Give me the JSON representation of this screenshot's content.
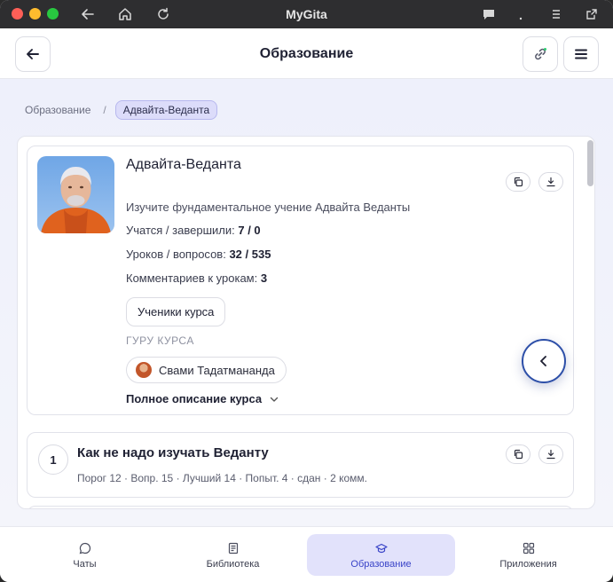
{
  "window": {
    "title": "MyGita"
  },
  "header": {
    "title": "Образование"
  },
  "breadcrumb": {
    "root": "Образование",
    "separator": "/",
    "current": "Адвайта-Веданта"
  },
  "course": {
    "title": "Адвайта-Веданта",
    "description": "Изучите фундаментальное учение Адвайта Веданты",
    "learning_label": "Учатся / завершили:",
    "learning_value": "7 / 0",
    "lessons_label": "Уроков / вопросов:",
    "lessons_value": "32 / 535",
    "comments_label": "Комментариев к урокам:",
    "comments_value": "3",
    "students_button": "Ученики курса",
    "guru_label": "ГУРУ КУРСА",
    "guru_name": "Свами Тадатмананда",
    "full_description": "Полное описание курса"
  },
  "lessons": [
    {
      "number": "1",
      "title": "Как не надо изучать Веданту",
      "meta": "Порог 12 · Вопр. 15 · Лучший 14 · Попыт. 4 · сдан · 2 комм."
    }
  ],
  "bottom_nav": [
    {
      "label": "Чаты",
      "icon": "chat-icon",
      "active": false
    },
    {
      "label": "Библиотека",
      "icon": "book-icon",
      "active": false
    },
    {
      "label": "Образование",
      "icon": "graduation-cap-icon",
      "active": true
    },
    {
      "label": "Приложения",
      "icon": "apps-grid-icon",
      "active": false
    }
  ],
  "colors": {
    "accent": "#3a44c8",
    "active_tab_bg": "#e2e2fb",
    "fab_border": "#2d4fa8"
  }
}
